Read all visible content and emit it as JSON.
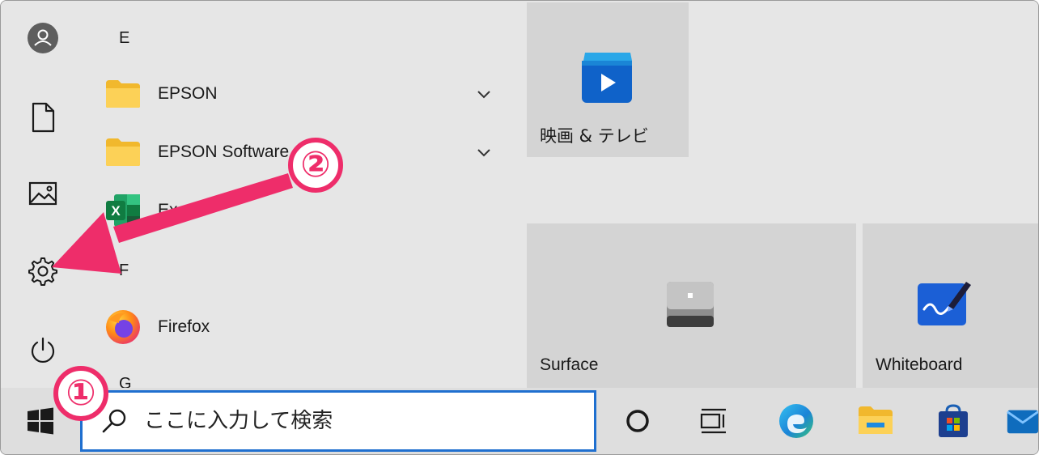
{
  "start_menu": {
    "rail": [
      {
        "icon": "user-icon",
        "label": "アカウント"
      },
      {
        "icon": "document-icon",
        "label": "ドキュメント"
      },
      {
        "icon": "pictures-icon",
        "label": "ピクチャ"
      },
      {
        "icon": "gear-icon",
        "label": "設定"
      },
      {
        "icon": "power-icon",
        "label": "電源"
      }
    ],
    "app_list": {
      "letter_e": "E",
      "letter_f": "F",
      "letter_g": "G",
      "apps": [
        {
          "label": "EPSON",
          "icon": "folder-icon"
        },
        {
          "label": "EPSON Software",
          "icon": "folder-icon"
        },
        {
          "label": "Excel",
          "icon": "excel-icon"
        },
        {
          "label": "Firefox",
          "icon": "firefox-icon"
        }
      ]
    },
    "tiles": [
      {
        "label": "映画 & テレビ",
        "icon": "movies-tv-icon"
      },
      {
        "label": "Surface",
        "icon": "surface-icon"
      },
      {
        "label": "Whiteboard",
        "icon": "whiteboard-icon"
      }
    ]
  },
  "taskbar": {
    "search": {
      "placeholder": "ここに入力して検索",
      "value": ""
    },
    "icons": [
      "windows-logo-icon",
      "cortana-icon",
      "task-view-icon",
      "edge-icon",
      "file-explorer-icon",
      "store-icon",
      "mail-icon"
    ]
  },
  "annotations": {
    "step1": "①",
    "step2": "②",
    "accent_color": "#ee2d6a"
  }
}
